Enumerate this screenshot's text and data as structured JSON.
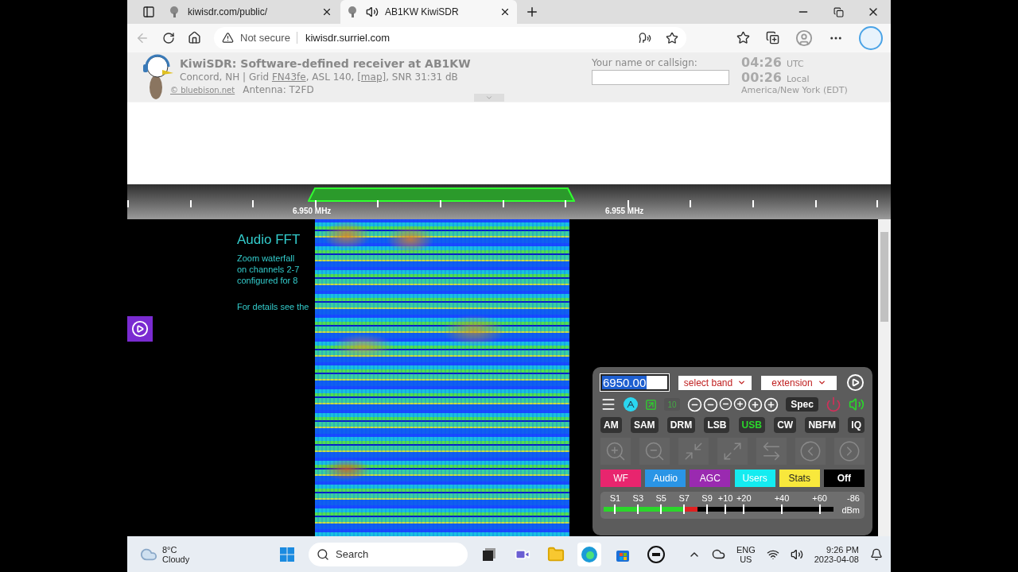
{
  "browser": {
    "tabs": [
      {
        "title": "kiwisdr.com/public/",
        "selected": false,
        "audio": false
      },
      {
        "title": "AB1KW KiwiSDR",
        "selected": true,
        "audio": true
      }
    ],
    "security": "Not secure",
    "url": "kiwisdr.surriel.com"
  },
  "header": {
    "title": "KiwiSDR: Software-defined receiver at AB1KW",
    "info": [
      {
        "text": "Concord, NH | Grid ",
        "link": false
      },
      {
        "text": "FN43fe",
        "link": true
      },
      {
        "text": ", ASL 140, ",
        "link": false
      },
      {
        "text": "[map]",
        "link": true
      },
      {
        "text": ", SNR 31:31 dB",
        "link": false
      }
    ],
    "credit": "© bluebison.net",
    "antenna": "Antenna: T2FD",
    "callsign_label": "Your name or callsign:",
    "utc_time": "04:26",
    "utc_label": "UTC",
    "local_time": "00:26",
    "local_label": "Local",
    "timezone": "America/New York (EDT)"
  },
  "scale": {
    "labels": [
      "6.950 MHz",
      "6.955 MHz"
    ]
  },
  "audio_fft": {
    "title": "Audio FFT",
    "lines": [
      "Zoom waterfall",
      "on channels 2-7",
      "configured for 8"
    ],
    "details": "For details see the"
  },
  "controls": {
    "frequency": "6950.00",
    "band": "select band",
    "extension": "extension",
    "badge": "10",
    "spec": "Spec",
    "modes": [
      {
        "label": "AM",
        "selected": false
      },
      {
        "label": "SAM",
        "selected": false
      },
      {
        "label": "DRM",
        "selected": false
      },
      {
        "label": "LSB",
        "selected": false
      },
      {
        "label": "USB",
        "selected": true
      },
      {
        "label": "CW",
        "selected": false
      },
      {
        "label": "NBFM",
        "selected": false
      },
      {
        "label": "IQ",
        "selected": false
      }
    ],
    "panels": [
      {
        "label": "WF",
        "color": "#e8256e"
      },
      {
        "label": "Audio",
        "color": "#2a95e6"
      },
      {
        "label": "AGC",
        "color": "#9a2ab0"
      },
      {
        "label": "Users",
        "color": "#14ecf0"
      },
      {
        "label": "Stats",
        "color": "#f8e83c"
      },
      {
        "label": "Off",
        "color": "#000000"
      }
    ],
    "smeter": {
      "labels": [
        "S1",
        "S3",
        "S5",
        "S7",
        "S9",
        "+10",
        "+20",
        "+40",
        "+60"
      ],
      "level": 0.41,
      "reading": "-86",
      "unit": "dBm"
    }
  },
  "taskbar": {
    "temperature": "8°C",
    "weather": "Cloudy",
    "search": "Search",
    "language": "ENG",
    "region": "US",
    "time": "9:26 PM",
    "date": "2023-04-08"
  }
}
